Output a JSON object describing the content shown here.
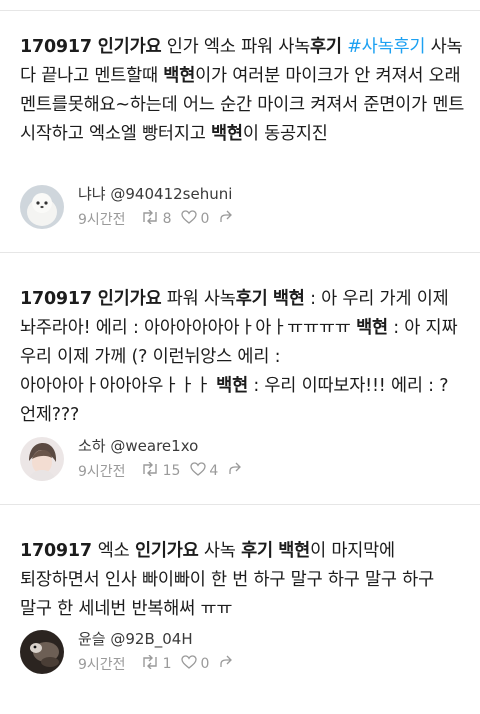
{
  "tweets": [
    {
      "segments": [
        {
          "text": "170917 ",
          "style": "b"
        },
        {
          "text": "인기가요",
          "style": "b"
        },
        {
          "text": " 인가 엑소 파워 사녹",
          "style": ""
        },
        {
          "text": "후기",
          "style": "b"
        },
        {
          "text": " ",
          "style": ""
        },
        {
          "text": "#사녹후기",
          "style": "hashtag"
        },
        {
          "text": " 사녹 다 끝나고 멘트할때 ",
          "style": ""
        },
        {
          "text": "백현",
          "style": "b"
        },
        {
          "text": "이가 여러분 마이크가 안 켜져서 오래 멘트를못해요~하는데 어느 순간 마이크 켜져서 준면이가 멘트 시작하고 엑소엘 빵터지고 ",
          "style": ""
        },
        {
          "text": "백현",
          "style": "b"
        },
        {
          "text": "이 동공지진",
          "style": ""
        }
      ],
      "author": {
        "display_name": "냐냐",
        "handle": "@940412sehuni"
      },
      "time": "9시간전",
      "retweets": "8",
      "likes": "0"
    },
    {
      "segments": [
        {
          "text": "170917 ",
          "style": "b"
        },
        {
          "text": "인기가요",
          "style": "b"
        },
        {
          "text": " 파워 사녹",
          "style": ""
        },
        {
          "text": "후기",
          "style": "b"
        },
        {
          "text": " ",
          "style": ""
        },
        {
          "text": "백현",
          "style": "b"
        },
        {
          "text": " : 아 우리 가게 이제 놔주라아! 에리 : 아아아아아아ㅏ아ㅏㅠㅠㅠㅠ ",
          "style": ""
        },
        {
          "text": "백현",
          "style": "b"
        },
        {
          "text": " : 아 지짜 우리 이제 가께 (? 이런뉘앙스 에리 : 아아아아ㅏ아아아우ㅏㅏㅏ ",
          "style": ""
        },
        {
          "text": "백현",
          "style": "b"
        },
        {
          "text": " : 우리 이따보자!!! 에리 : ? 언제???",
          "style": ""
        }
      ],
      "author": {
        "display_name": "소하",
        "handle": "@weare1xo"
      },
      "time": "9시간전",
      "retweets": "15",
      "likes": "4"
    },
    {
      "segments": [
        {
          "text": "170917 ",
          "style": "b"
        },
        {
          "text": "엑소 ",
          "style": ""
        },
        {
          "text": "인기가요",
          "style": "b"
        },
        {
          "text": " 사녹 ",
          "style": ""
        },
        {
          "text": "후기",
          "style": "b"
        },
        {
          "text": " ",
          "style": ""
        },
        {
          "text": "백현",
          "style": "b"
        },
        {
          "text": "이 마지막에 퇴장하면서 인사 빠이빠이 한 번 하구 말구 하구 말구 하구 말구 한 세네번 반복해써 ㅠㅠ",
          "style": ""
        }
      ],
      "author": {
        "display_name": "윤슬",
        "handle": "@92B_04H"
      },
      "time": "9시간전",
      "retweets": "1",
      "likes": "0"
    }
  ],
  "colors": {
    "hashtag": "#1da1f2",
    "meta": "#9a9a9a",
    "divider": "#e6e6e6"
  },
  "icons": {
    "retweet": "retweet-icon",
    "like": "heart-icon",
    "share": "share-icon"
  }
}
